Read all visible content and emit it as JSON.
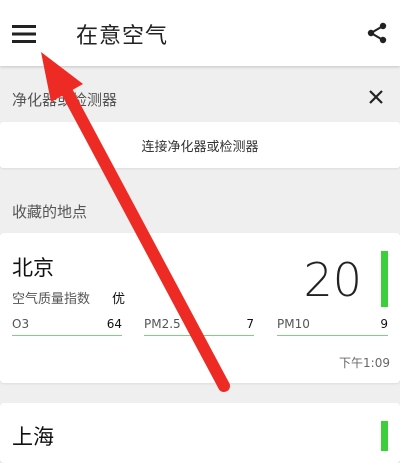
{
  "appbar": {
    "title": "在意空气"
  },
  "purifier_section": {
    "title": "净化器或检测器",
    "connect_label": "连接净化器或检测器"
  },
  "favorites": {
    "title": "收藏的地点",
    "cities": [
      {
        "name": "北京",
        "aqi_label": "空气质量指数",
        "aqi_level": "优",
        "aqi": "20",
        "aqi_fraction": 1.0,
        "pollutants": [
          {
            "name": "O3",
            "value": "64"
          },
          {
            "name": "PM2.5",
            "value": "7"
          },
          {
            "name": "PM10",
            "value": "9"
          }
        ],
        "time": "下午1:09"
      },
      {
        "name": "上海",
        "aqi_fraction": 1.0
      }
    ]
  },
  "colors": {
    "accent_green": "#3ccf3c",
    "annotation_arrow": "#ee2a24"
  }
}
